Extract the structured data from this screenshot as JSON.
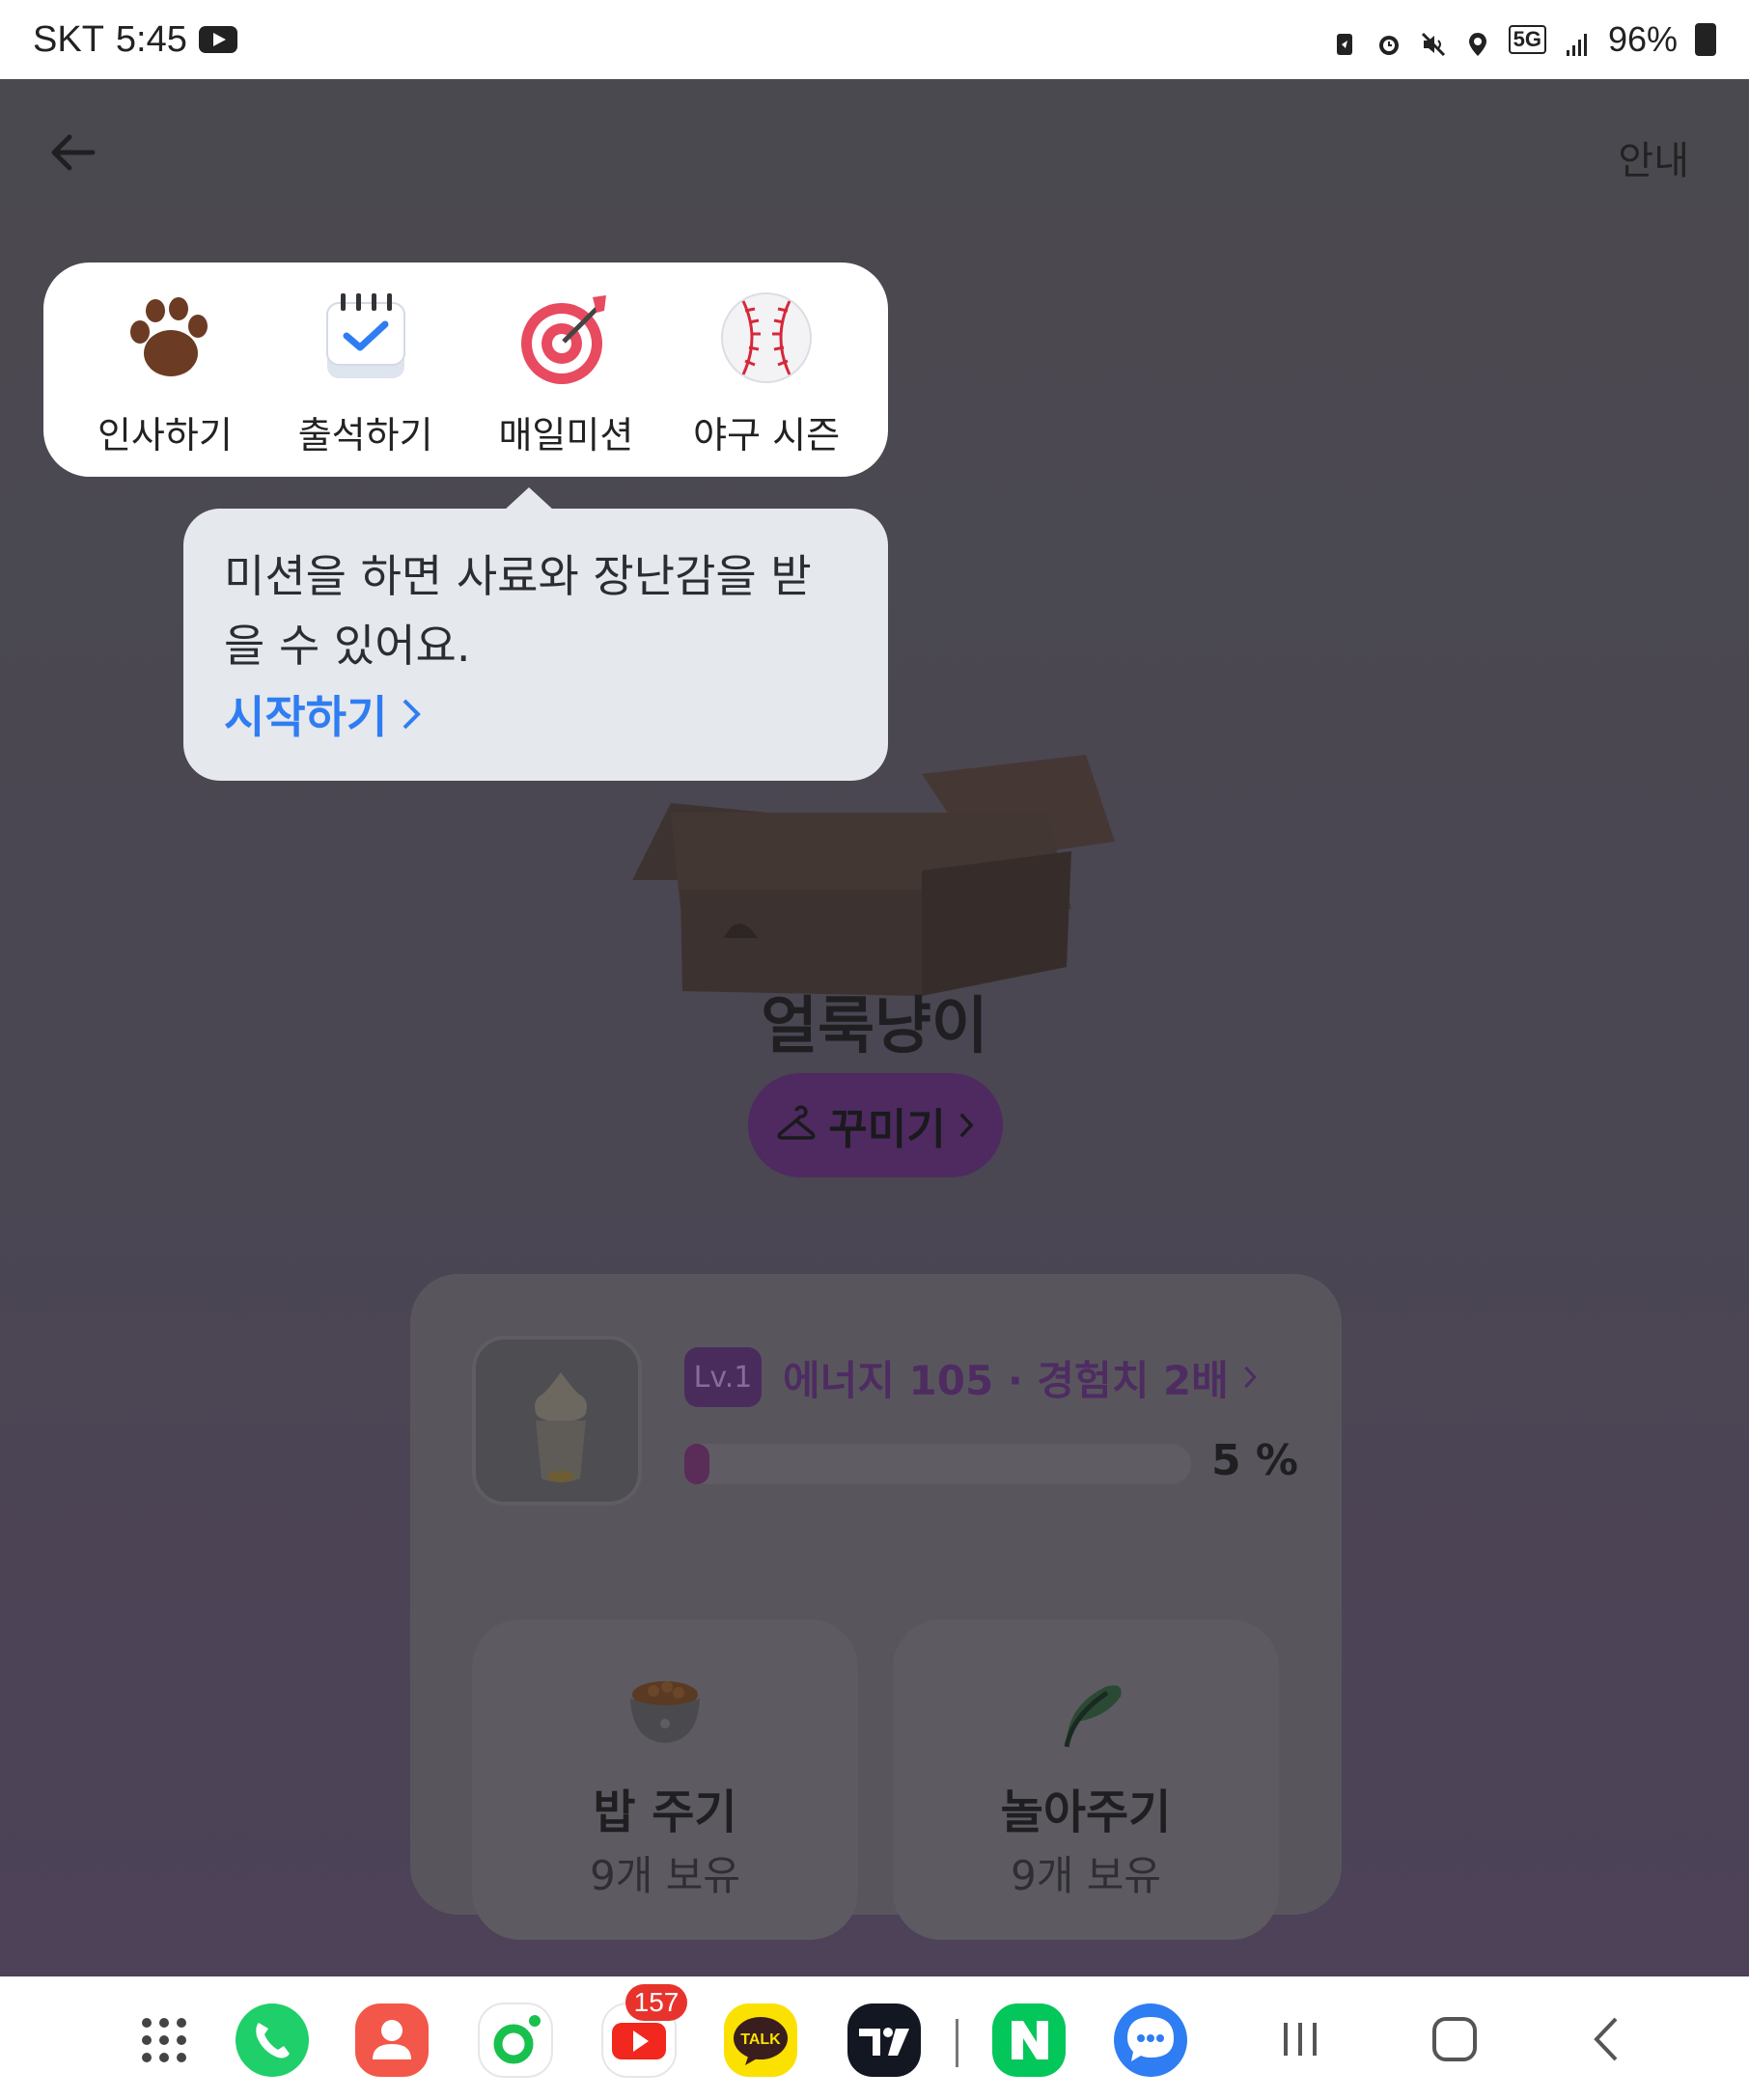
{
  "status_bar": {
    "carrier": "SKT",
    "time": "5:45",
    "battery": "96%",
    "network": "5G"
  },
  "header": {
    "back_icon": "arrow-left-icon",
    "guide_label": "안내"
  },
  "missions": [
    {
      "label": "인사하기",
      "icon": "paw-icon"
    },
    {
      "label": "출석하기",
      "icon": "calendar-check-icon"
    },
    {
      "label": "매일미션",
      "icon": "target-dart-icon"
    },
    {
      "label": "야구 시즌",
      "icon": "baseball-icon"
    }
  ],
  "tooltip": {
    "message": "미션을 하면 사료와 장난감을 받을 수 있어요.",
    "link_label": "시작하기"
  },
  "pet": {
    "name": "얼룩냥이",
    "decorate_label": "꾸미기"
  },
  "stats": {
    "level": "Lv.1",
    "energy_text": "에너지 105 · 경험치 2배",
    "progress_value": 5,
    "progress_text": "5 %"
  },
  "actions": {
    "feed": {
      "title": "밥 주기",
      "sub": "9개 보유"
    },
    "play": {
      "title": "놀아주기",
      "sub": "9개 보유"
    }
  },
  "taskbar": {
    "apps": [
      "app-drawer",
      "phone",
      "contacts",
      "camera",
      "youtube",
      "kakaotalk",
      "tradingview",
      "naver",
      "messages"
    ],
    "youtube_badge": "157",
    "kakao_label": "TALK"
  },
  "colors": {
    "tooltip_link": "#2f7df2",
    "accent_purple": "#4e2a60",
    "popup_bg": "#ffffff",
    "dim_overlay": "#4b4950"
  }
}
